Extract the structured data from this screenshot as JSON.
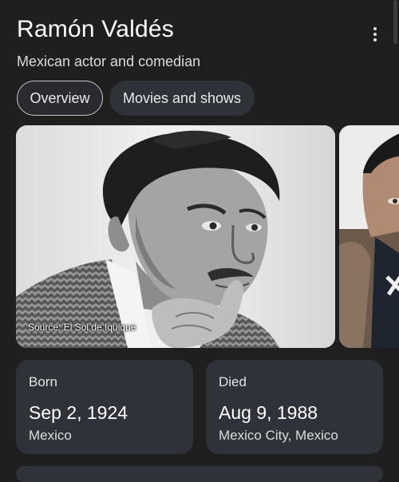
{
  "entity": {
    "name": "Ramón Valdés",
    "description": "Mexican actor and comedian"
  },
  "menu": {
    "icon": "more-vert-icon"
  },
  "tabs": [
    {
      "label": "Overview",
      "selected": true
    },
    {
      "label": "Movies and shows",
      "selected": false
    }
  ],
  "images": {
    "main_source": "Source: El Sol de Iquique"
  },
  "facts": {
    "born": {
      "label": "Born",
      "date": "Sep 2, 1924",
      "place": "Mexico"
    },
    "died": {
      "label": "Died",
      "date": "Aug 9, 1988",
      "place": "Mexico City, Mexico"
    }
  }
}
